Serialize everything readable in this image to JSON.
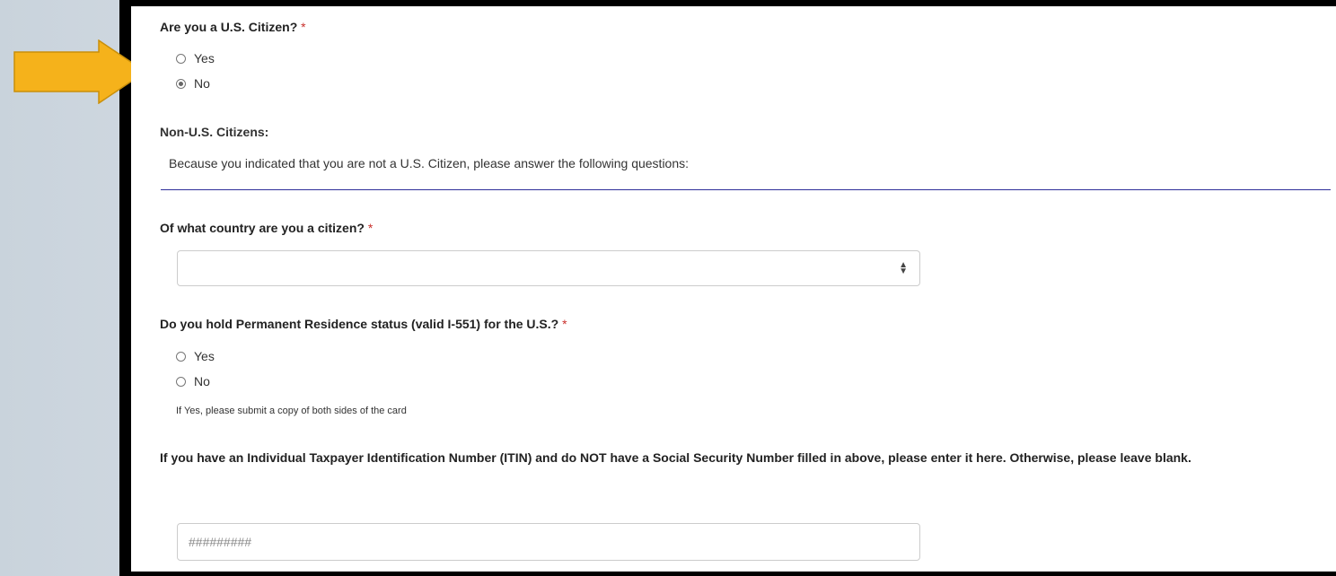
{
  "citizen_question": {
    "label": "Are you a U.S. Citizen?",
    "required": "*",
    "options": [
      "Yes",
      "No"
    ],
    "selected": "No"
  },
  "non_citizen_section": {
    "title": "Non-U.S. Citizens:",
    "description": "Because you indicated that you are not a U.S. Citizen, please answer the following questions:"
  },
  "country_question": {
    "label": "Of what country are you a citizen?",
    "required": "*",
    "value": ""
  },
  "residence_question": {
    "label": "Do you hold Permanent Residence status (valid I-551) for the U.S.?",
    "required": "*",
    "options": [
      "Yes",
      "No"
    ],
    "selected": null,
    "help": "If Yes, please submit a copy of both sides of the card"
  },
  "itin_question": {
    "label": "If you have an Individual Taxpayer Identification Number (ITIN) and do NOT have a Social Security Number filled in above, please enter it here. Otherwise, please leave blank.",
    "placeholder": "#########"
  },
  "colors": {
    "arrow": "#f5b21b",
    "required": "#c9302c",
    "divider": "#2e2e9a"
  },
  "icons": {
    "pointer": "arrow-right-icon",
    "select": "sort-caret-icon"
  }
}
